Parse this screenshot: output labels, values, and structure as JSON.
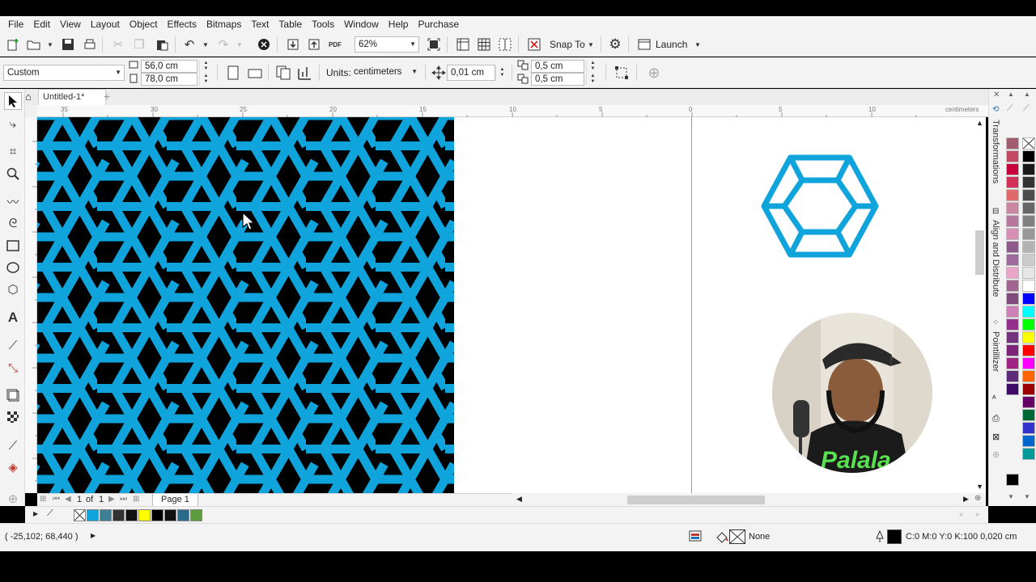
{
  "menu": [
    "File",
    "Edit",
    "View",
    "Layout",
    "Object",
    "Effects",
    "Bitmaps",
    "Text",
    "Table",
    "Tools",
    "Window",
    "Help",
    "Purchase"
  ],
  "toolbar": {
    "zoom": "62%",
    "snap_to": "Snap To",
    "launch": "Launch"
  },
  "property_bar": {
    "page_size": "Custom",
    "width": "56,0 cm",
    "height": "78,0 cm",
    "units_label": "Units:",
    "units_value": "centimeters",
    "nudge": "0,01 cm",
    "dup_x": "0,5 cm",
    "dup_y": "0,5 cm"
  },
  "document": {
    "tab_title": "Untitled-1*"
  },
  "ruler": {
    "unit": "centimeters",
    "h_ticks": [
      "35",
      "30",
      "25",
      "20",
      "15",
      "10",
      "5",
      "0",
      "5",
      "10"
    ]
  },
  "page_nav": {
    "current": "1",
    "of_label": "of",
    "total": "1",
    "page_tab": "Page 1"
  },
  "dockers": [
    "Transformations",
    "Align and Distribute",
    "Pointillizer"
  ],
  "status": {
    "coords": "( -25,102; 68,440 )",
    "fill_label": "None",
    "outline_label": "C:0 M:0 Y:0 K:100  0,020 cm"
  },
  "colors": {
    "pattern_blue": "#0fa4dc",
    "pattern_bg": "#000000",
    "palette": [
      "#a15d6d",
      "#c44a64",
      "#c8003c",
      "#d2305a",
      "#e06a6a",
      "#cb87a1",
      "#b6789c",
      "#d88fb4",
      "#8d5a8a",
      "#9e6a9e",
      "#e8a5c8",
      "#a1648f",
      "#7f4a7c",
      "#cc80b5",
      "#95318c",
      "#76337d",
      "#7d2679",
      "#a02482",
      "#5e2c78",
      "#3d0a67"
    ],
    "palette_gray": [
      "#000000",
      "#1a1a1a",
      "#333333",
      "#4d4d4d",
      "#666666",
      "#808080",
      "#999999",
      "#b3b3b3",
      "#cccccc",
      "#e6e6e6",
      "#ffffff",
      "#0000ff",
      "#00ffff",
      "#00ff00",
      "#ffff00",
      "#ff0000",
      "#ff00ff",
      "#ff6600",
      "#990000",
      "#660066",
      "#006633",
      "#3333cc",
      "#0066cc",
      "#009999"
    ],
    "doc_palette": [
      "#0fa4dc",
      "#3e7f93",
      "#333333",
      "#111111",
      "#ffff00",
      "#000000",
      "#111111",
      "#2a6b8c",
      "#5e9c3f"
    ]
  }
}
